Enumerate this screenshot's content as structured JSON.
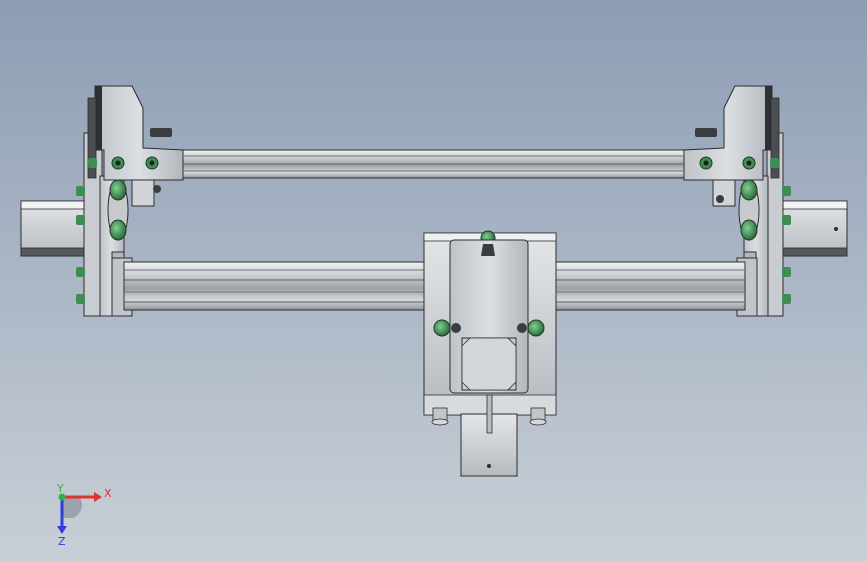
{
  "viewport": {
    "background_top": "#8d9db4",
    "background_bottom": "#c9cfd6"
  },
  "model": {
    "parts": [
      "left-end-plate",
      "right-end-plate",
      "top-rail",
      "lower-rail",
      "left-side-block",
      "right-side-block",
      "center-carriage",
      "motor-flange",
      "lower-mount-block",
      "slide-post"
    ],
    "colors": {
      "metal_light": "#d9dcdf",
      "metal_mid": "#b9bdc2",
      "metal_dark": "#8e9399",
      "edge": "#2b2d30",
      "fastener_green": "#3f8d52",
      "fastener_dark": "#3a3d40"
    }
  },
  "triad": {
    "x_label": "X",
    "y_label": "Y",
    "z_label": "Z",
    "x_color": "#e0322e",
    "y_color": "#2fb34a",
    "z_color": "#2d3fd8"
  }
}
